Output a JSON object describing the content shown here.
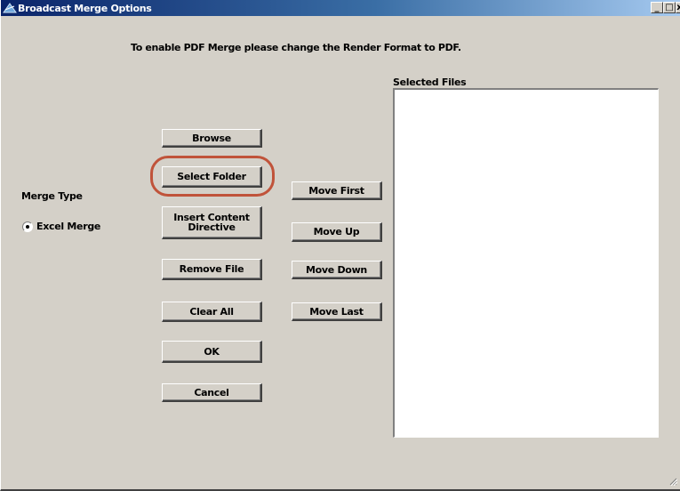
{
  "window": {
    "title": "Broadcast Merge Options",
    "minimize": "_",
    "maximize": "□",
    "close": "x"
  },
  "notice": "To enable PDF Merge please change the Render Format to PDF.",
  "selected_files": {
    "label": "Selected Files",
    "items": []
  },
  "buttons": {
    "browse": "Browse",
    "select_folder": "Select Folder",
    "insert_content_directive": "Insert Content Directive",
    "remove_file": "Remove File",
    "clear_all": "Clear All",
    "ok": "OK",
    "cancel": "Cancel",
    "move_first": "Move First",
    "move_up": "Move Up",
    "move_down": "Move Down",
    "move_last": "Move Last"
  },
  "merge_type": {
    "label": "Merge Type",
    "option": "Excel Merge",
    "selected": true
  },
  "highlight_color": "#c0533a"
}
